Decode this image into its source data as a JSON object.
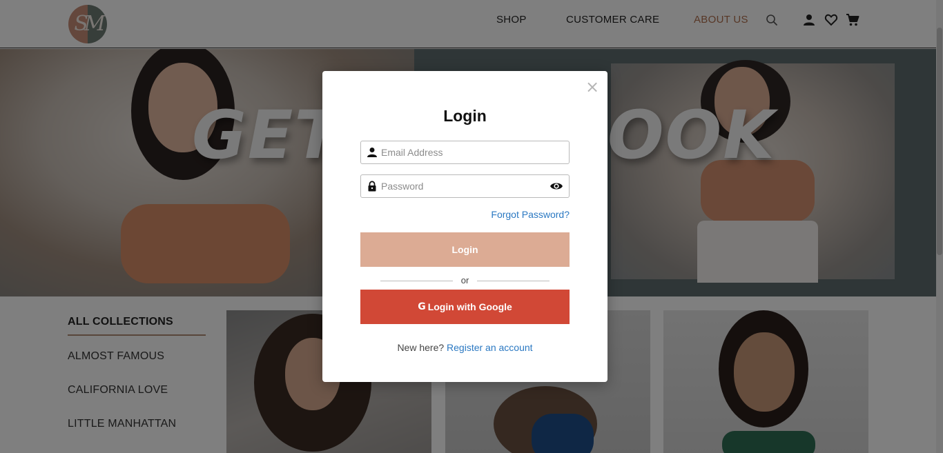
{
  "header": {
    "logo_text": "SM",
    "nav": [
      {
        "label": "SHOP"
      },
      {
        "label": "CUSTOMER CARE"
      },
      {
        "label": "ABOUT US"
      }
    ],
    "icons": [
      "search-icon",
      "user-icon",
      "heart-icon",
      "cart-icon"
    ]
  },
  "hero": {
    "text_left": "GET",
    "text_right": "OOK"
  },
  "collections": {
    "title": "ALL COLLECTIONS",
    "items": [
      "ALMOST FAMOUS",
      "CALIFORNIA LOVE",
      "LITTLE MANHATTAN"
    ]
  },
  "modal": {
    "close": "×",
    "title": "Login",
    "email_placeholder": "Email Address",
    "password_placeholder": "Password",
    "forgot": "Forgot Password?",
    "login_button": "Login",
    "or": "or",
    "google_icon": "G",
    "google_button": "Login with Google",
    "new_here": "New here?",
    "register": "Register an account"
  },
  "colors": {
    "accent_about": "#b06f4d",
    "login_button": "#dcab94",
    "google_button": "#d14836",
    "link": "#2a78c2"
  }
}
